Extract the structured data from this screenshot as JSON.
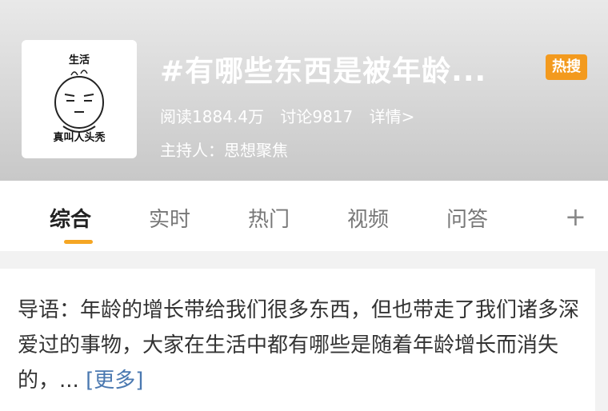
{
  "cover": {
    "top_text": "生活",
    "bottom_text": "真叫人头秃"
  },
  "topic": {
    "title": "#有哪些东西是被年龄...",
    "badge": "热搜",
    "reads": "阅读1884.4万",
    "discussions": "讨论9817",
    "details": "详情>",
    "host": "主持人：思想聚焦"
  },
  "tabs": [
    {
      "label": "综合"
    },
    {
      "label": "实时"
    },
    {
      "label": "热门"
    },
    {
      "label": "视频"
    },
    {
      "label": "问答"
    }
  ],
  "add_tab_label": "+",
  "intro": {
    "text": "导语：年龄的增长带给我们很多东西，但也带走了我们诸多深爱过的事物，大家在生活中都有哪些是随着年龄增长而消失的，... ",
    "more_label": "[更多]"
  }
}
